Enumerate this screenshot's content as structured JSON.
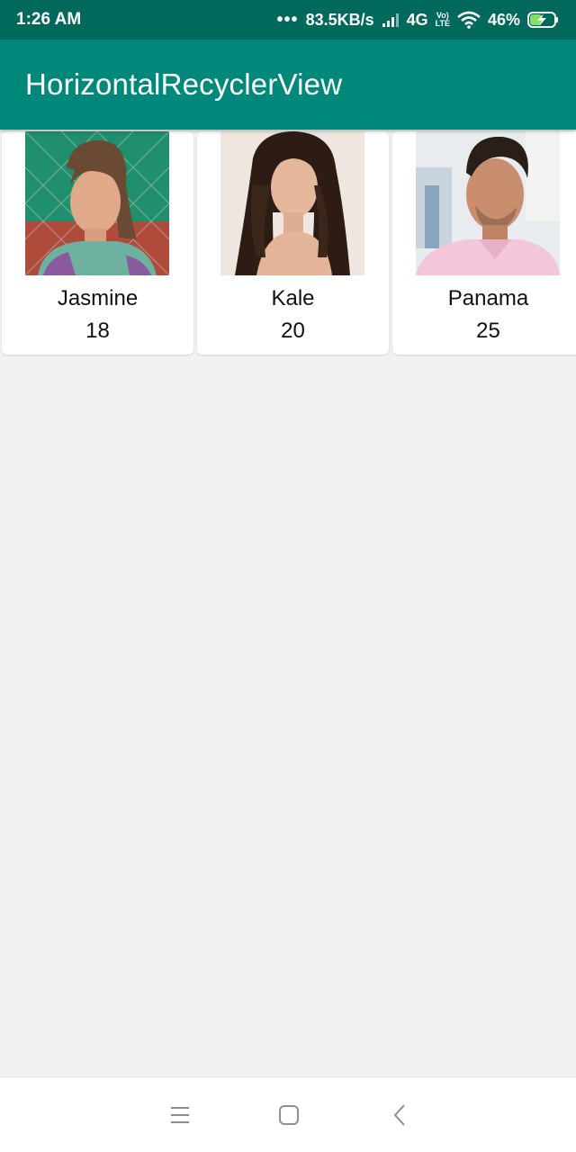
{
  "status_bar": {
    "time": "1:26 AM",
    "dots": "•••",
    "network_speed": "83.5KB/s",
    "network_type": "4G",
    "volte_top": "Vo)",
    "volte_bottom": "LTE",
    "battery_percent": "46%",
    "icons": [
      "signal-icon",
      "wifi-icon",
      "battery-charging-icon"
    ]
  },
  "app_bar": {
    "title": "HorizontalRecyclerView",
    "color": "#00897b",
    "status_color": "#00695c"
  },
  "items": [
    {
      "name": "Jasmine",
      "age": "18"
    },
    {
      "name": "Kale",
      "age": "20"
    },
    {
      "name": "Panama",
      "age": "25"
    }
  ],
  "nav_bar": {
    "icons": [
      "menu-icon",
      "home-square-icon",
      "back-chevron-icon"
    ]
  }
}
